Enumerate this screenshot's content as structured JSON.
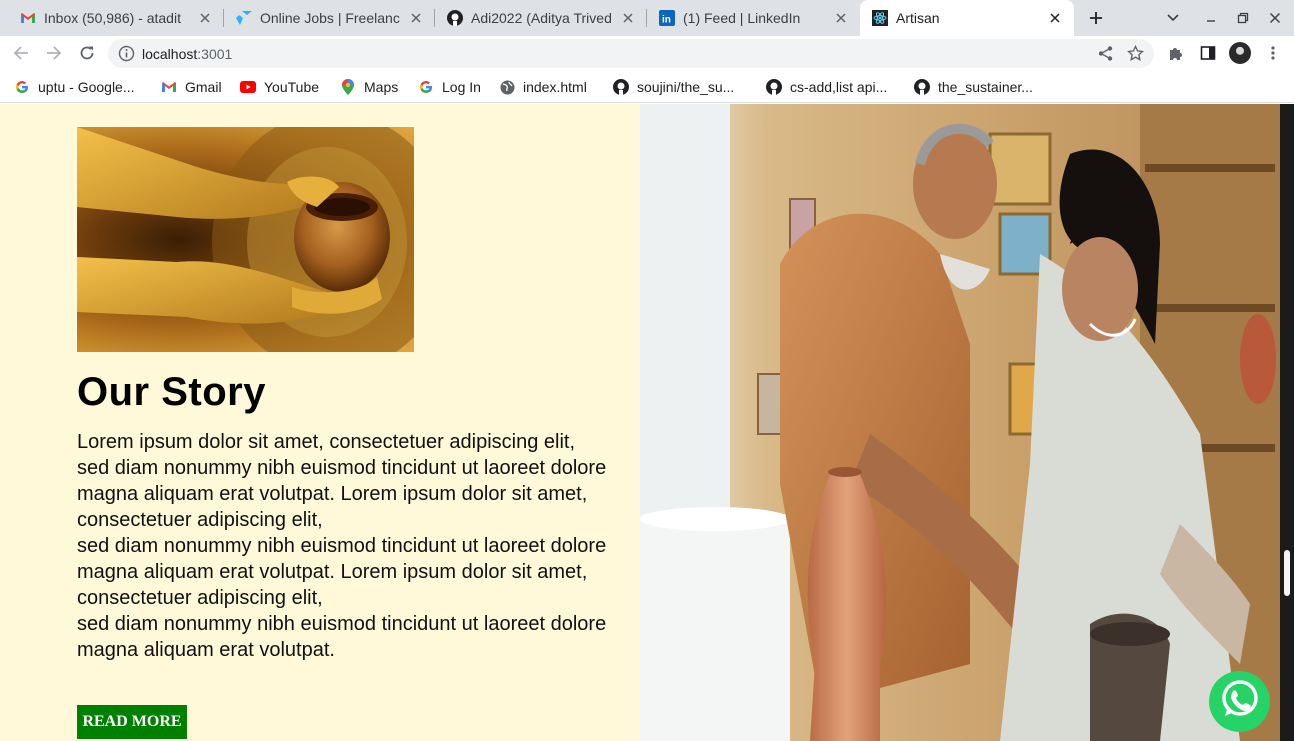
{
  "browser": {
    "tabs": [
      {
        "title": "Inbox (50,986) - atadit",
        "icon": "gmail-icon"
      },
      {
        "title": "Online Jobs | Freelanc",
        "icon": "freelancer-icon"
      },
      {
        "title": "Adi2022 (Aditya Trived",
        "icon": "github-icon"
      },
      {
        "title": "(1) Feed | LinkedIn",
        "icon": "linkedin-icon"
      },
      {
        "title": "Artisan",
        "icon": "react-icon",
        "active": true
      }
    ],
    "url_host": "localhost",
    "url_port": ":3001",
    "bookmarks": [
      {
        "label": "uptu - Google...",
        "icon": "google-icon"
      },
      {
        "label": "Gmail",
        "icon": "gmail-icon"
      },
      {
        "label": "YouTube",
        "icon": "youtube-icon"
      },
      {
        "label": "Maps",
        "icon": "maps-icon"
      },
      {
        "label": "Log In",
        "icon": "google-icon"
      },
      {
        "label": "index.html",
        "icon": "globe-icon"
      },
      {
        "label": "soujini/the_su...",
        "icon": "github-icon"
      },
      {
        "label": "cs-add,list api...",
        "icon": "github-icon"
      },
      {
        "label": "the_sustainer...",
        "icon": "github-icon"
      }
    ]
  },
  "page": {
    "story_title": "Our Story",
    "story_paragraphs": [
      "Lorem ipsum dolor sit amet, consectetuer adipiscing elit,",
      "sed diam nonummy nibh euismod tincidunt ut laoreet dolore magna aliquam erat volutpat. Lorem ipsum dolor sit amet, consectetuer adipiscing elit,",
      "sed diam nonummy nibh euismod tincidunt ut laoreet dolore magna aliquam erat volutpat. Lorem ipsum dolor sit amet, consectetuer adipiscing elit,",
      "sed diam nonummy nibh euismod tincidunt ut laoreet dolore magna aliquam erat volutpat."
    ],
    "read_more_label": "READ MORE",
    "colors": {
      "left_background": "#fff9d9",
      "button_green": "#008000",
      "whatsapp_green": "#25d366"
    }
  }
}
